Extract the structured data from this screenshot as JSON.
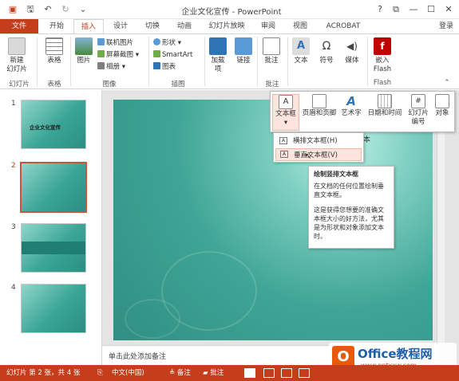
{
  "titlebar": {
    "title": "企业文化宣传 - PowerPoint",
    "help": "?",
    "restore": "⧉",
    "minimize": "—",
    "maximize": "☐",
    "close": "✕",
    "login": "登录"
  },
  "tabs": [
    "文件",
    "开始",
    "插入",
    "设计",
    "切换",
    "动画",
    "幻灯片放映",
    "审阅",
    "视图",
    "ACROBAT"
  ],
  "ribbon": {
    "new_slide": "新建\n幻灯片",
    "table": "表格",
    "picture": "图片",
    "online_picture": "联机图片",
    "screenshot": "屏幕截图",
    "album": "相册",
    "shapes": "形状",
    "smartart": "SmartArt",
    "chart": "图表",
    "addins": "加载\n项",
    "links": "链接",
    "comment": "批注",
    "text": "文本",
    "symbol": "符号",
    "media": "媒体",
    "flash": "嵌入\nFlash",
    "groups": {
      "slides": "幻灯片",
      "tables": "表格",
      "images": "图像",
      "illustrations": "插图",
      "comments": "批注",
      "flash": "Flash"
    }
  },
  "slides": [
    {
      "num": "1",
      "title": "企业文化宣传"
    },
    {
      "num": "2"
    },
    {
      "num": "3"
    },
    {
      "num": "4"
    }
  ],
  "notes_placeholder": "单击此处添加备注",
  "gallery": {
    "textbox": "文本框",
    "header_footer": "页眉和页脚",
    "wordart": "艺术字",
    "datetime": "日期和时间",
    "slide_number": "幻灯片\n编号",
    "object": "对象",
    "text_label": "文本"
  },
  "submenu": {
    "horizontal": "横排文本框(H)",
    "vertical": "垂直文本框(V)"
  },
  "tooltip": {
    "title": "绘制竖排文本框",
    "line1": "在文档的任何位置绘制垂直文本框。",
    "line2": "这是获得您想要的准确文本框大小的好方法，尤其是为形状和对象添加文本时。"
  },
  "status": {
    "slide_info": "幻灯片 第 2 张，共 4 张",
    "language": "中文(中国)",
    "notes": "备注",
    "comments": "批注"
  },
  "watermark": {
    "brand": "Office教程网",
    "url": "www.pptxxw.com"
  },
  "colors": {
    "accent": "#c43e1c",
    "teal": "#3aa596"
  }
}
